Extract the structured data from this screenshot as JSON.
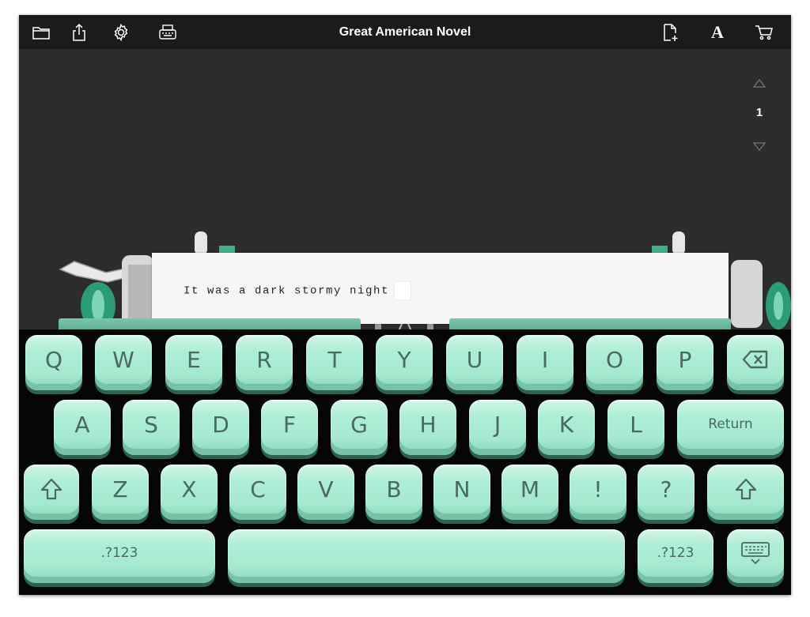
{
  "toolbar": {
    "title": "Great American Novel",
    "font_glyph": "A",
    "left_icons": [
      "folder-icon",
      "share-icon",
      "gear-icon",
      "typewriter-icon"
    ],
    "right_icons": [
      "new-page-icon",
      "font-icon",
      "cart-icon"
    ]
  },
  "page_nav": {
    "page": "1"
  },
  "paper": {
    "text": "It was a dark stormy night"
  },
  "keyboard": {
    "row1": [
      "Q",
      "W",
      "E",
      "R",
      "T",
      "Y",
      "U",
      "I",
      "O",
      "P"
    ],
    "row2": [
      "A",
      "S",
      "D",
      "F",
      "G",
      "H",
      "J",
      "K",
      "L"
    ],
    "row3": [
      "Z",
      "X",
      "C",
      "V",
      "B",
      "N",
      "M",
      "!",
      "?"
    ],
    "return_label": "Return",
    "numbers_label": ".?123",
    "icons": [
      "backspace-icon",
      "shift-icon",
      "keyboard-hide-icon"
    ]
  },
  "colors": {
    "key": "#a8ebd3",
    "toolbar": "#1b1b1b",
    "background": "#2c2c2c",
    "paper": "#f6f6f6"
  }
}
